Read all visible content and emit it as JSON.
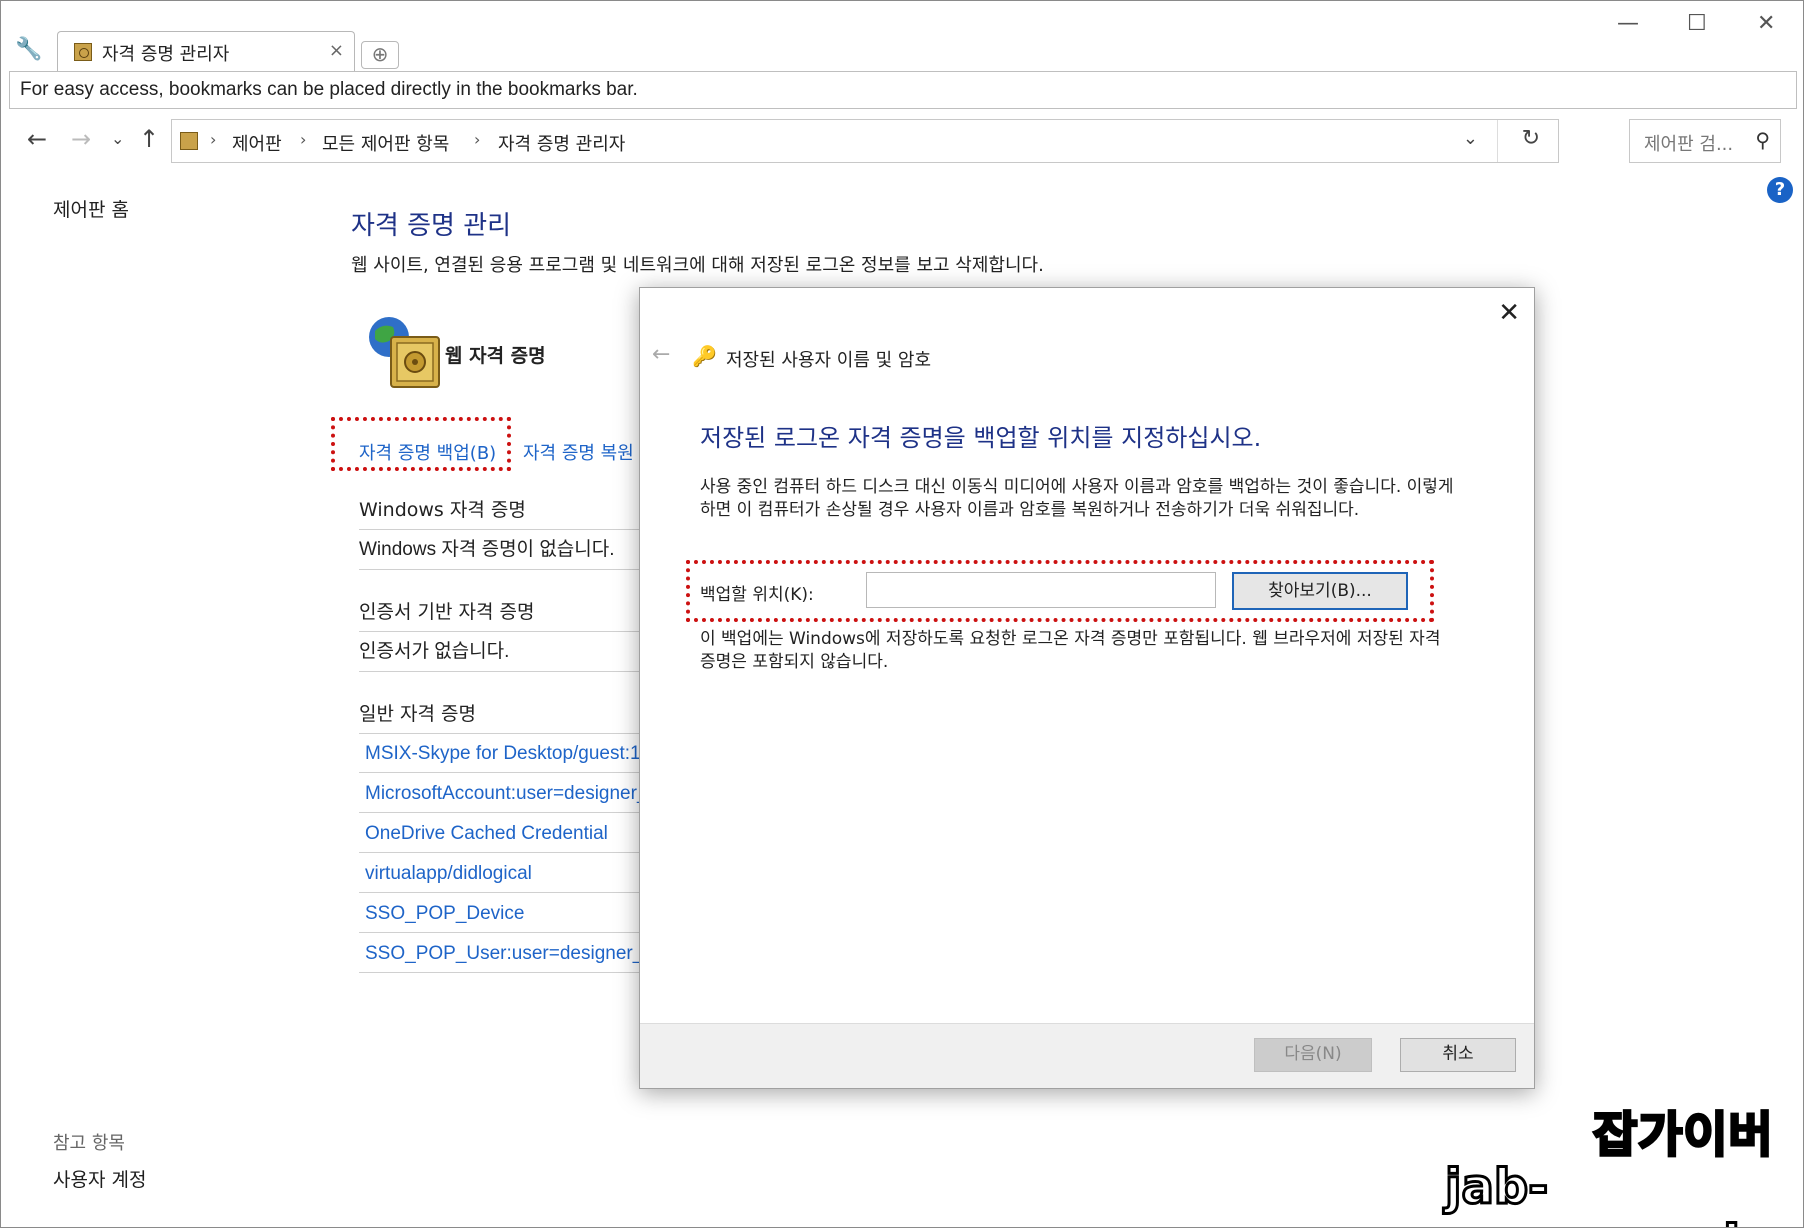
{
  "browser": {
    "tab_title": "자격 증명 관리자",
    "tab_close": "×",
    "new_tab": "⊕",
    "bookmark_hint": "For easy access, bookmarks can be placed directly in the bookmarks bar.",
    "window_controls": [
      "—",
      "☐",
      "✕"
    ]
  },
  "address": {
    "breadcrumbs": [
      "제어판",
      "모든 제어판 항목",
      "자격 증명 관리자"
    ],
    "search_placeholder": "제어판 검..."
  },
  "sidebar": {
    "home": "제어판 홈",
    "see_also": "참고 항목",
    "user_accounts": "사용자 계정"
  },
  "main": {
    "title": "자격 증명 관리",
    "description": "웹 사이트, 연결된 응용 프로그램 및 네트워크에 대해 저장된 로그온 정보를 보고 삭제합니다.",
    "web_credentials": "웹 자격 증명",
    "backup_link": "자격 증명 백업(B)",
    "restore_link": "자격 증명 복원",
    "windows_section": "Windows 자격 증명",
    "windows_empty": "Windows 자격 증명이 없습니다.",
    "cert_section": "인증서 기반 자격 증명",
    "cert_empty": "인증서가 없습니다.",
    "generic_section": "일반 자격 증명",
    "generic_items": [
      "MSIX-Skype for Desktop/guest:1",
      "MicrosoftAccount:user=designer_",
      "OneDrive Cached Credential",
      "virtualapp/didlogical",
      "SSO_POP_Device",
      "SSO_POP_User:user=designer_ew"
    ]
  },
  "dialog": {
    "header": "저장된 사용자 이름 및 암호",
    "instruction": "저장된 로그온 자격 증명을 백업할 위치를 지정하십시오.",
    "paragraph": "사용 중인 컴퓨터 하드 디스크 대신 이동식 미디어에 사용자 이름과 암호를 백업하는 것이 좋습니다. 이렇게 하면 이 컴퓨터가 손상될 경우 사용자 이름과 암호를 복원하거나 전송하기가 더욱 쉬워집니다.",
    "location_label": "백업할 위치(K):",
    "location_value": "",
    "browse_button": "찾아보기(B)...",
    "note": "이 백업에는 Windows에 저장하도록 요청한 로그온 자격 증명만 포함됩니다. 웹 브라우저에 저장된 자격 증명은 포함되지 않습니다.",
    "next_button": "다음(N)",
    "cancel_button": "취소"
  },
  "watermark": {
    "korean": "잡가이버",
    "url": "jab-guyver.co.kr"
  }
}
